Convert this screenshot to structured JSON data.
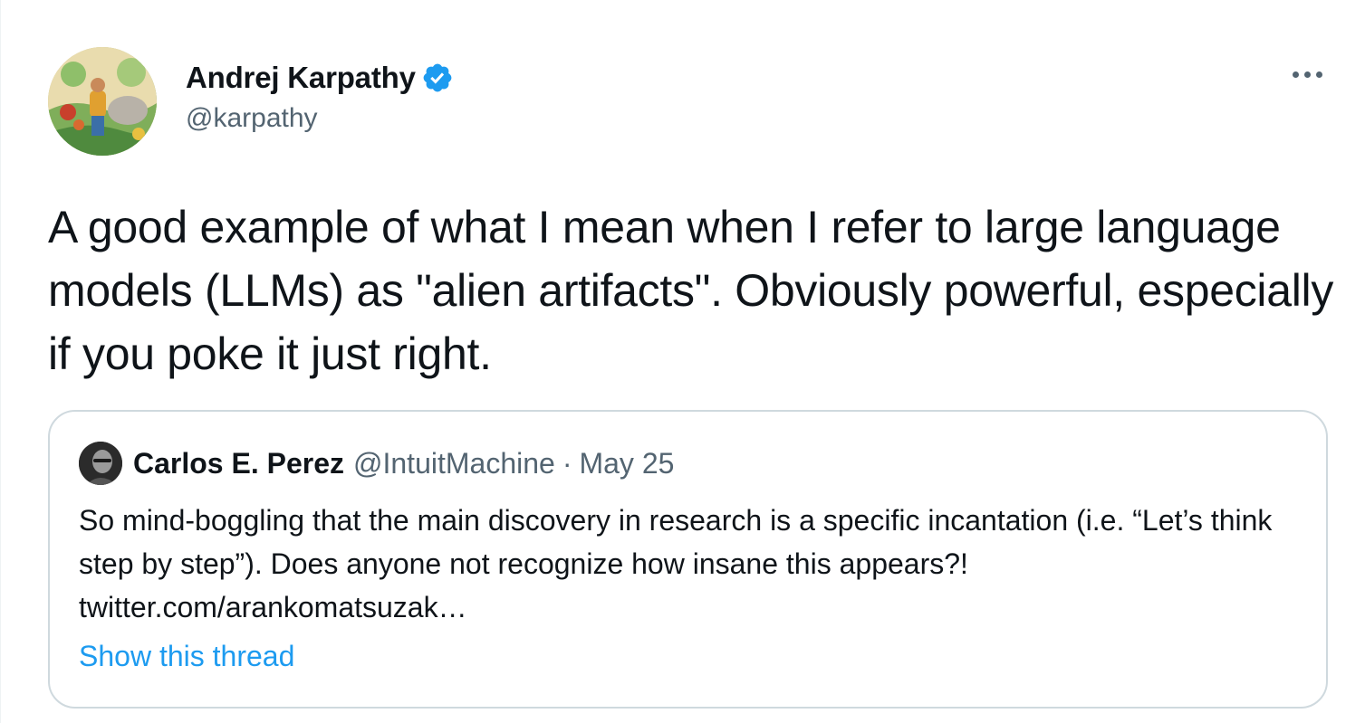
{
  "author": {
    "display_name": "Andrej Karpathy",
    "handle": "@karpathy",
    "verified": true,
    "avatar_icon": "profile-illustration"
  },
  "tweet": {
    "text": "A good example of what I mean when I refer to large language models (LLMs) as \"alien artifacts\". Obviously powerful, especially if you poke it just right."
  },
  "quoted_tweet": {
    "display_name": "Carlos E. Perez",
    "handle": "@IntuitMachine",
    "separator": "·",
    "date": "May 25",
    "text": "So mind-boggling that the main discovery in research is a specific incantation (i.e. “Let’s think step by step”).  Does anyone not recognize how insane this appears?! twitter.com/arankomatsuzak…",
    "show_thread_label": "Show this thread"
  },
  "icons": {
    "verified": "verified-badge-icon",
    "more": "more-options-icon"
  },
  "colors": {
    "accent": "#1d9bf0",
    "text_primary": "#0f1419",
    "text_secondary": "#536471",
    "border": "#cfd9de"
  }
}
